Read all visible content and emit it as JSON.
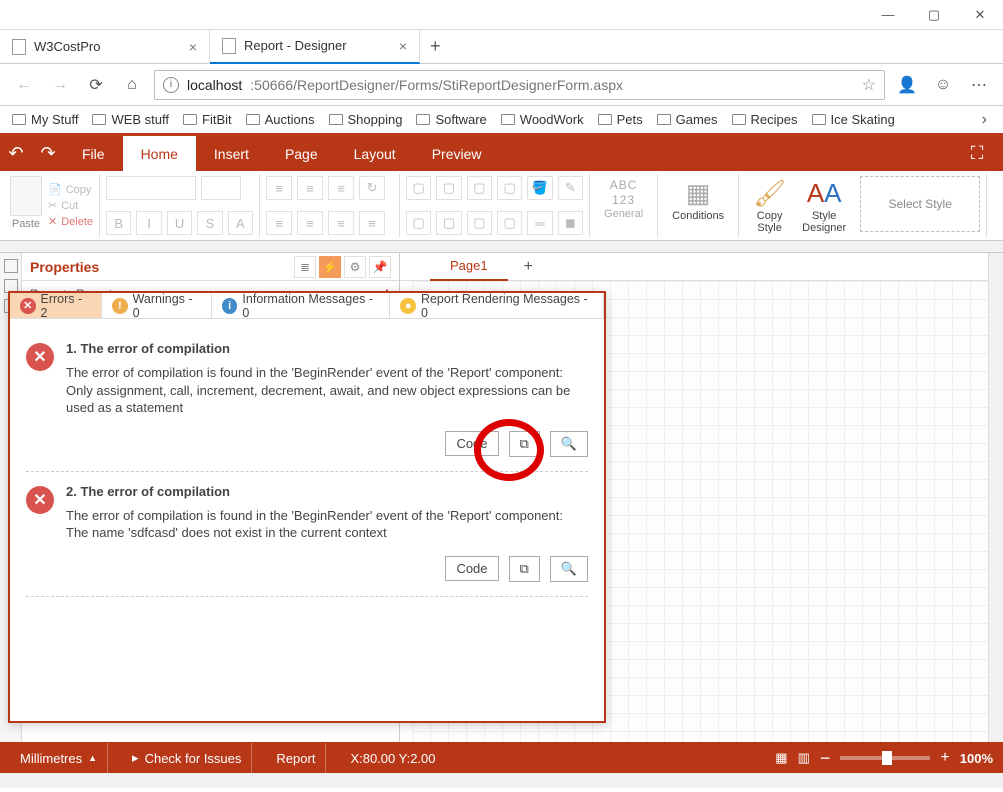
{
  "browser": {
    "tabs": [
      {
        "title": "W3CostPro",
        "active": false
      },
      {
        "title": "Report - Designer",
        "active": true
      }
    ],
    "nav": {
      "back": "←",
      "forward": "→",
      "refresh": "⟳",
      "home": "⌂"
    },
    "url_segments": {
      "scheme": "localhost",
      "host_rest": ":50666/ReportDesigner/Forms/StiReportDesignerForm.aspx"
    },
    "bookmarks": [
      "My Stuff",
      "WEB stuff",
      "FitBit",
      "Auctions",
      "Shopping",
      "Software",
      "WoodWork",
      "Pets",
      "Games",
      "Recipes",
      "Ice Skating"
    ],
    "titlebar": {
      "minimize": "—",
      "maximize": "▢",
      "close": "✕"
    },
    "toolbar_icons": {
      "person": "👤",
      "smiley": "☺",
      "more": "⋯",
      "star": "☆"
    }
  },
  "ribbon": {
    "undo": "↶",
    "redo": "↷",
    "tabs": [
      "File",
      "Home",
      "Insert",
      "Page",
      "Layout",
      "Preview"
    ],
    "active_tab": "Home",
    "fullscreen_icon": "⛶",
    "clipboard": {
      "paste": "Paste",
      "copy": "Copy",
      "cut": "Cut",
      "delete": "Delete"
    },
    "font_buttons": [
      "B",
      "I",
      "U",
      "S",
      "A"
    ],
    "general": {
      "abc": "ABC",
      "num": "123",
      "label": "General"
    },
    "conditions": "Conditions",
    "copy_style": "Copy\nStyle",
    "style_designer": "Style\nDesigner",
    "select_style": "Select Style"
  },
  "left": {
    "rail_icons": [
      "▤",
      "▤",
      "▤"
    ],
    "properties": {
      "title": "Properties",
      "dropdown_value": "Report : Report",
      "header_icons": {
        "list": "≣",
        "bolt": "⚡",
        "gear": "⚙",
        "pin": "📌"
      }
    }
  },
  "design": {
    "page_tab": "Page1",
    "page_plus": "+"
  },
  "errors": {
    "tabs": {
      "errors": "Errors - 2",
      "warnings": "Warnings - 0",
      "info": "Information Messages - 0",
      "render": "Report Rendering Messages - 0"
    },
    "items": [
      {
        "n": "1.",
        "title": "The error of compilation",
        "text": "The error of compilation is found in the 'BeginRender' event of the 'Report' component: Only assignment, call, increment, decrement, await, and new object expressions can be used as a statement",
        "code_label": "Code"
      },
      {
        "n": "2.",
        "title": "The error of compilation",
        "text": "The error of compilation is found in the 'BeginRender' event of the 'Report' component: The name 'sdfcasd' does not exist in the current context",
        "code_label": "Code"
      }
    ],
    "action_icons": {
      "copy": "⧉",
      "search": "🔍"
    }
  },
  "status": {
    "units": "Millimetres",
    "units_arrow": "▲",
    "play": "▸",
    "check": "Check for Issues",
    "report": "Report",
    "coords": "X:80.00 Y:2.00",
    "views": {
      "a": "▦",
      "b": "▥"
    },
    "zoom_minus": "−",
    "zoom_plus": "+",
    "zoom_pct": "100%"
  }
}
